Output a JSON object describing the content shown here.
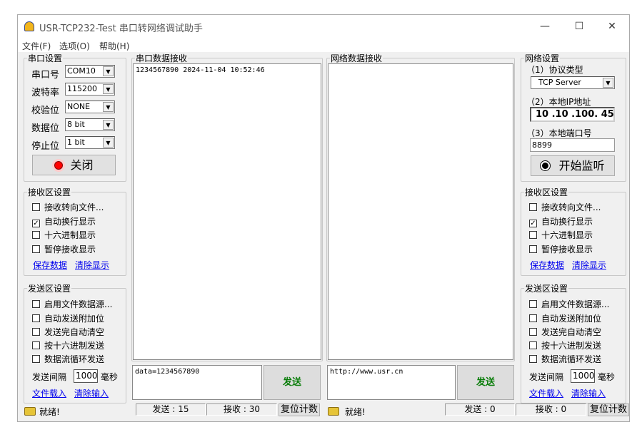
{
  "window": {
    "title": "USR-TCP232-Test 串口转网络调试助手",
    "minimize": "—",
    "maximize": "☐",
    "close": "✕"
  },
  "menu": [
    "文件(F)",
    "选项(O)",
    "帮助(H)"
  ],
  "serial_settings": {
    "legend": "串口设置",
    "rows": [
      {
        "label": "串口号",
        "value": "COM10"
      },
      {
        "label": "波特率",
        "value": "115200"
      },
      {
        "label": "校验位",
        "value": "NONE"
      },
      {
        "label": "数据位",
        "value": "8 bit"
      },
      {
        "label": "停止位",
        "value": "1 bit"
      }
    ],
    "button": "关闭"
  },
  "recv_settings": {
    "legend": "接收区设置",
    "options": [
      {
        "label": "接收转向文件...",
        "checked": false
      },
      {
        "label": "自动换行显示",
        "checked": true
      },
      {
        "label": "十六进制显示",
        "checked": false
      },
      {
        "label": "暂停接收显示",
        "checked": false
      }
    ],
    "save": "保存数据",
    "clear": "清除显示"
  },
  "send_settings": {
    "legend": "发送区设置",
    "options": [
      {
        "label": "启用文件数据源...",
        "checked": false
      },
      {
        "label": "自动发送附加位",
        "checked": false
      },
      {
        "label": "发送完自动清空",
        "checked": false
      },
      {
        "label": "按十六进制发送",
        "checked": false
      },
      {
        "label": "数据流循环发送",
        "checked": false
      }
    ],
    "interval_label": "发送间隔",
    "interval": "1000",
    "unit": "毫秒",
    "load": "文件载入",
    "clear": "清除输入"
  },
  "serial_recv": {
    "legend": "串口数据接收",
    "content": "1234567890 2024-11-04 10:52:46",
    "send_text": "data=1234567890",
    "send_button": "发送"
  },
  "net_recv": {
    "legend": "网络数据接收",
    "content": "",
    "send_text": "http://www.usr.cn",
    "send_button": "发送"
  },
  "net_settings": {
    "legend": "网络设置",
    "protocol_label": "（1）协议类型",
    "protocol": "TCP Server",
    "ip_label": "（2）本地IP地址",
    "ip": "10 .10 .100. 45",
    "port_label": "（3）本地端口号",
    "port": "8899",
    "button": "开始监听"
  },
  "status_left": {
    "text": "就绪!",
    "sent": "发送 : 15",
    "recv": "接收 : 30",
    "reset": "复位计数"
  },
  "status_right": {
    "text": "就绪!",
    "sent": "发送 : 0",
    "recv": "接收 : 0",
    "reset": "复位计数"
  }
}
